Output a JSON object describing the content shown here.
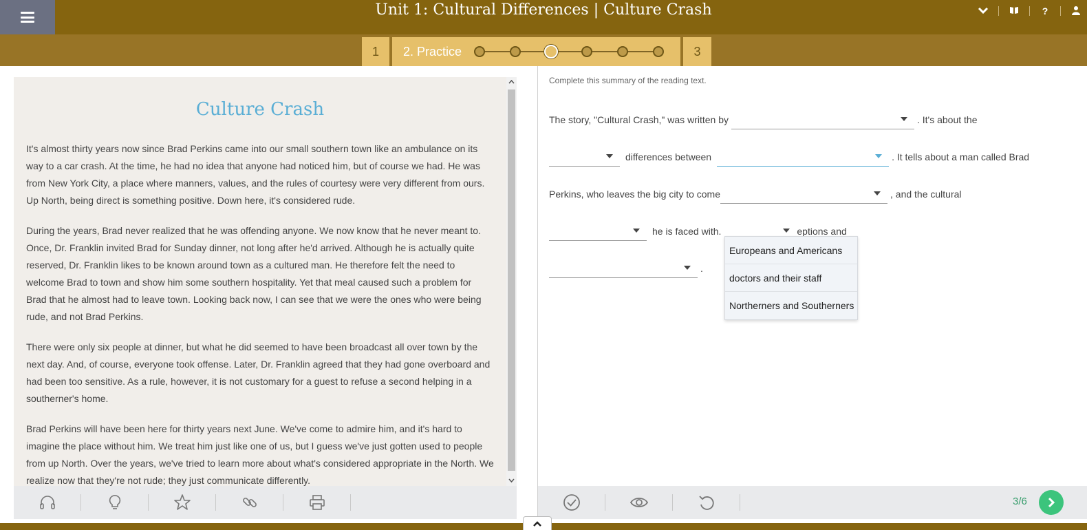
{
  "header": {
    "title": "Unit 1: Cultural Differences | Culture Crash",
    "icons": [
      "menu-icon",
      "chevron-down-icon",
      "book-icon",
      "help-icon",
      "user-icon"
    ],
    "help_glyph": "?"
  },
  "steps": {
    "prev": "1",
    "current": "2. Practice",
    "next": "3",
    "dot_count": 6,
    "active_dot": 3
  },
  "reading": {
    "title": "Culture Crash",
    "paragraphs": [
      "It's almost thirty years now since Brad Perkins came into our small southern town like an ambulance on its way to a car crash. At the time, he had no idea that anyone had noticed him, but of course we had. He was from New York City, a place where manners, values, and the rules of courtesy were very different from ours. Up North, being direct is something positive. Down here, it's considered rude.",
      "During the years, Brad never realized that he was offending anyone. We now know that he never meant to. Once, Dr. Franklin invited Brad for Sunday dinner, not long after he'd arrived. Although he is actually quite reserved, Dr. Franklin likes to be known around town as a cultured man. He therefore felt the need to welcome Brad to town and show him some southern hospitality. Yet that meal caused such a problem for Brad that he almost had to leave town. Looking back now, I can see that we were the ones who were being rude, and not Brad Perkins.",
      "There were only six people at dinner, but what he did seemed to have been broadcast all over town by the next day. And, of course, everyone took offense. Later, Dr. Franklin agreed that they had gone overboard and had been too sensitive. As a rule, however, it is not customary for a guest to refuse a second helping in a southerner's home.",
      "Brad Perkins will have been here for thirty years next June. We've come to admire him, and it's hard to imagine the place without him. We treat him just like one of us, but I guess we've just gotten used to people from up North. Over the years, we've tried to learn more about what's considered appropriate in the North. We realize now that they're not rude; they just communicate differently."
    ],
    "tools": [
      "headphones-icon",
      "lightbulb-icon",
      "star-icon",
      "link-icon",
      "printer-icon"
    ]
  },
  "exercise": {
    "instruction": "Complete this summary of the reading text.",
    "line1_a": "The story, \"Cultural Crash,\" was written by",
    "line1_b": ". It's about the",
    "line2_a": "differences between",
    "line2_b": ". It tells about a man called Brad",
    "line3_a": "Perkins, who leaves the big city to come",
    "line3_b": ", and the cultural",
    "line4_a": "he is faced with.",
    "line4_b": "eptions and",
    "line5_end": ".",
    "dropdown_options": [
      "Europeans and Americans",
      "doctors and their staff",
      "Northerners and Southerners"
    ],
    "tools": [
      "check-icon",
      "eye-icon",
      "undo-icon"
    ],
    "counter": "3/6"
  }
}
